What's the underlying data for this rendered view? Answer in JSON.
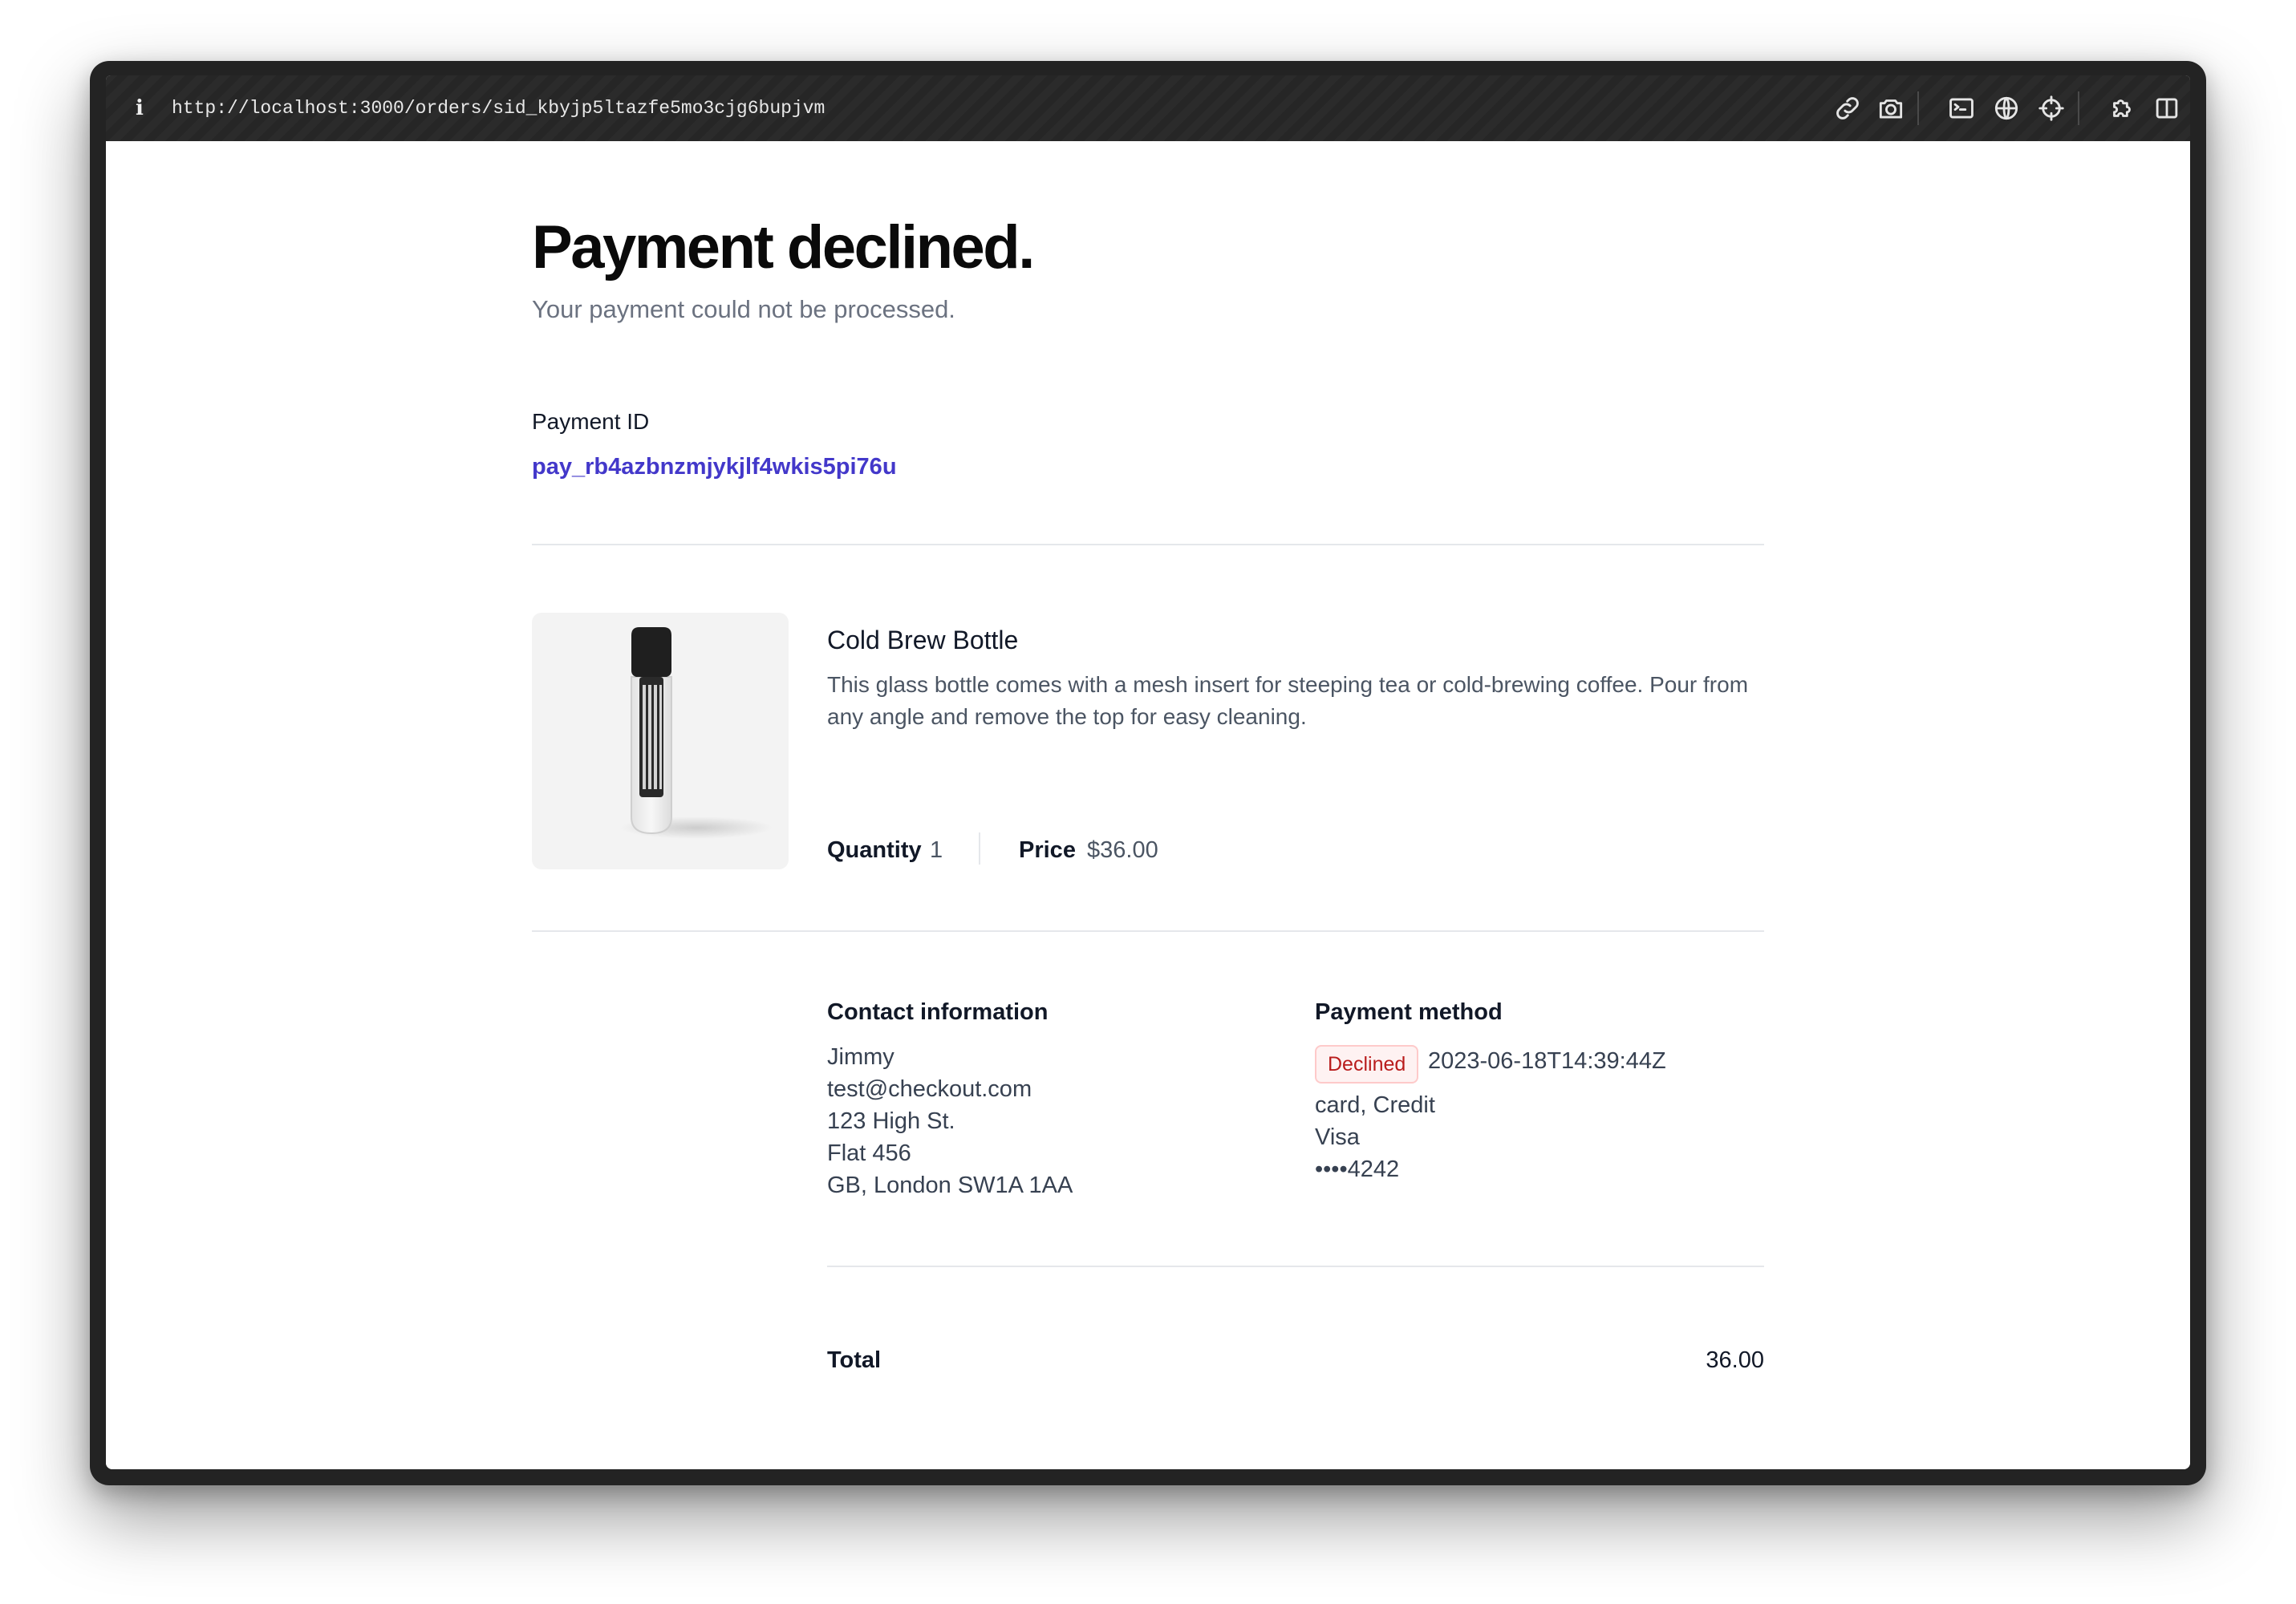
{
  "browser": {
    "url": "http://localhost:3000/orders/sid_kbyjp5ltazfe5mo3cjg6bupjvm",
    "icons": [
      "link-icon",
      "camera-icon",
      "terminal-icon",
      "globe-icon",
      "crosshair-icon",
      "extensions-icon",
      "split-view-icon"
    ]
  },
  "page": {
    "title": "Payment declined.",
    "subtitle": "Your payment could not be processed."
  },
  "payment_id": {
    "label": "Payment ID",
    "value": "pay_rb4azbnzmjykjlf4wkis5pi76u"
  },
  "product": {
    "name": "Cold Brew Bottle",
    "description": "This glass bottle comes with a mesh insert for steeping tea or cold-brewing coffee. Pour from any angle and remove the top for easy cleaning.",
    "quantity_label": "Quantity",
    "quantity": "1",
    "price_label": "Price",
    "price": "$36.00"
  },
  "contact": {
    "label": "Contact information",
    "lines": [
      "Jimmy",
      "test@checkout.com",
      "123 High St.",
      "Flat 456",
      "GB, London SW1A 1AA"
    ]
  },
  "payment_method": {
    "label": "Payment method",
    "status": "Declined",
    "status_color": "#b91c1c",
    "date": "2023-06-18T14:39:44Z",
    "lines": [
      "card, Credit",
      "Visa",
      "••••4242"
    ]
  },
  "total": {
    "label": "Total",
    "value": "36.00"
  },
  "colors": {
    "accent": "#4338ca",
    "declined_bg": "#fef2f2"
  }
}
